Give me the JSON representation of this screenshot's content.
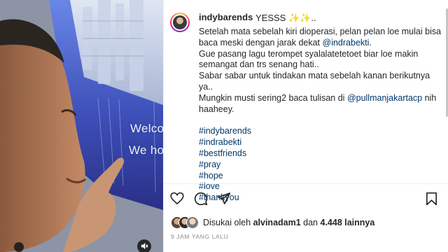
{
  "post": {
    "username": "indybarends",
    "headline": "YESSS ✨✨..",
    "caption_lines": [
      "Setelah mata sebelah kiri dioperasi, pelan pelan loe mulai bisa",
      "baca meski dengan jarak dekat",
      "Gue pasang lagu terompet syalalatetetoet biar loe makin",
      "semangat dan trs senang hati..",
      "Sabar sabar untuk tindakan mata sebelah kanan berikutnya ya..",
      "Mungkin musti sering2 baca tulisan di",
      "haaheey."
    ],
    "mention_1": "@indrabekti",
    "mention_1_suffix": ".",
    "mention_2": "@pullmanjakartacp",
    "mention_2_suffix": " nih",
    "hashtags": [
      "#indybarends",
      "#indrabekti",
      "#bestfriends",
      "#pray",
      "#hope",
      "#love",
      "#thankyou"
    ]
  },
  "photo": {
    "screen_line_1": "Welcom",
    "screen_line_2": "We hop"
  },
  "likes": {
    "prefix": "Disukai oleh",
    "user": "alvinadam1",
    "middle": "dan",
    "count": "4.448 lainnya"
  },
  "timestamp": "9 JAM YANG LALU",
  "icons": [
    "heart-icon",
    "comment-icon",
    "share-icon",
    "bookmark-icon",
    "mute-icon"
  ],
  "colors": {
    "link": "#00376b",
    "text": "#262626",
    "muted": "#8e8e8e"
  }
}
